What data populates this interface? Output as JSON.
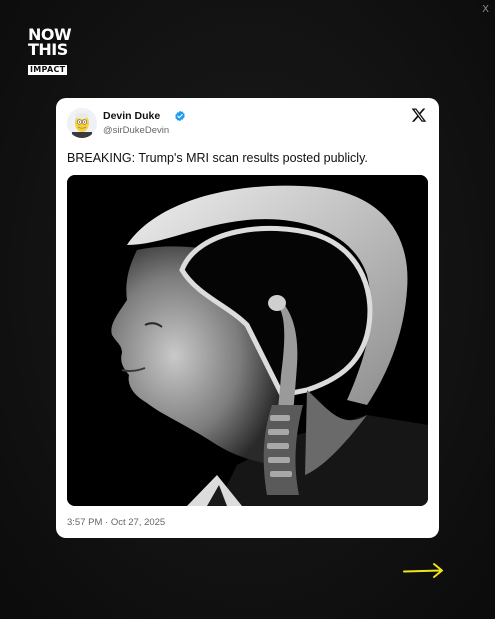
{
  "close_label": "X",
  "logo": {
    "line1": "NOW",
    "line2": "THIS",
    "line3": "IMPACT"
  },
  "tweet": {
    "author_name": "Devin Duke",
    "handle": "@sirDukeDevin",
    "text": "BREAKING: Trump's MRI scan results posted publicly.",
    "timestamp": "3:57 PM · Oct 27, 2025",
    "verified": true,
    "media_description_icon": "mri-portrait-image"
  },
  "icons": {
    "verified": "verified-badge-icon",
    "platform": "x-logo-icon",
    "next": "arrow-right-icon"
  },
  "colors": {
    "background": "#121212",
    "card": "#ffffff",
    "verified_blue": "#1d9bf0",
    "arrow_yellow": "#f2e21d"
  }
}
